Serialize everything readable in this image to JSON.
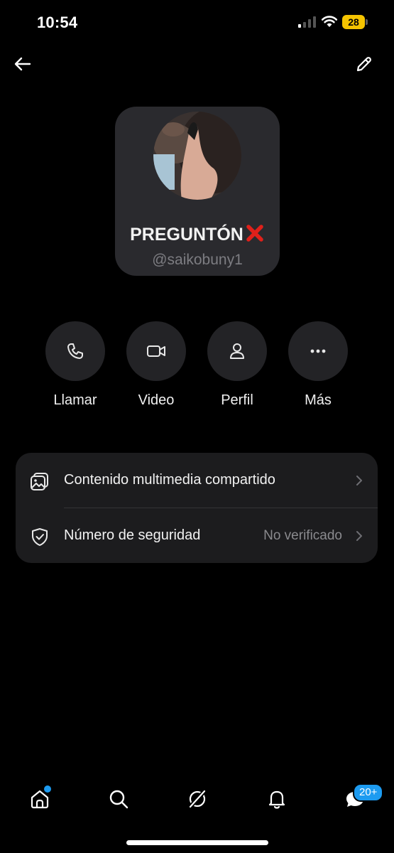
{
  "status": {
    "time": "10:54",
    "battery": "28",
    "battery_color": "#f5c400"
  },
  "header": {
    "back_icon": "arrow-left-icon",
    "edit_icon": "pencil-icon"
  },
  "profile": {
    "name": "PREGUNTÓN",
    "name_emoji": "cross-mark-icon",
    "handle": "@saikobuny1"
  },
  "actions": [
    {
      "label": "Llamar",
      "icon": "phone-icon"
    },
    {
      "label": "Video",
      "icon": "video-camera-icon"
    },
    {
      "label": "Perfil",
      "icon": "person-icon"
    },
    {
      "label": "Más",
      "icon": "more-icon"
    }
  ],
  "settings": [
    {
      "label": "Contenido multimedia compartido",
      "value": "",
      "icon": "media-gallery-icon"
    },
    {
      "label": "Número de seguridad",
      "value": "No verificado",
      "icon": "shield-check-icon"
    }
  ],
  "tab_bar": {
    "items": [
      "home-icon",
      "search-icon",
      "grok-icon",
      "notifications-bell-icon",
      "messages-icon"
    ],
    "messages_badge": "20+",
    "accent": "#1d9bf0"
  }
}
